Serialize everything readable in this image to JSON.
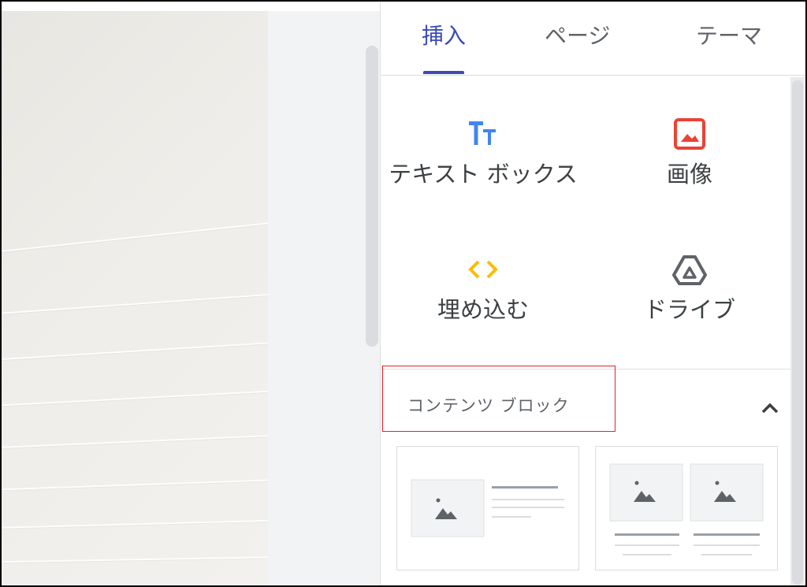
{
  "tabs": [
    {
      "label": "挿入",
      "active": true
    },
    {
      "label": "ページ",
      "active": false
    },
    {
      "label": "テーマ",
      "active": false
    }
  ],
  "insert_items": [
    {
      "label": "テキスト ボックス",
      "icon": "text-box-icon",
      "color": "#4285f4"
    },
    {
      "label": "画像",
      "icon": "image-icon",
      "color": "#ea4335"
    },
    {
      "label": "埋め込む",
      "icon": "embed-icon",
      "color": "#fbbc04"
    },
    {
      "label": "ドライブ",
      "icon": "drive-icon",
      "color": "#5f6368"
    }
  ],
  "content_blocks": {
    "title": "コンテンツ ブロック",
    "expanded": true,
    "icon": "chevron-up-icon"
  },
  "colors": {
    "accent": "#3c4cb4",
    "highlight_box": "#e0232d"
  }
}
